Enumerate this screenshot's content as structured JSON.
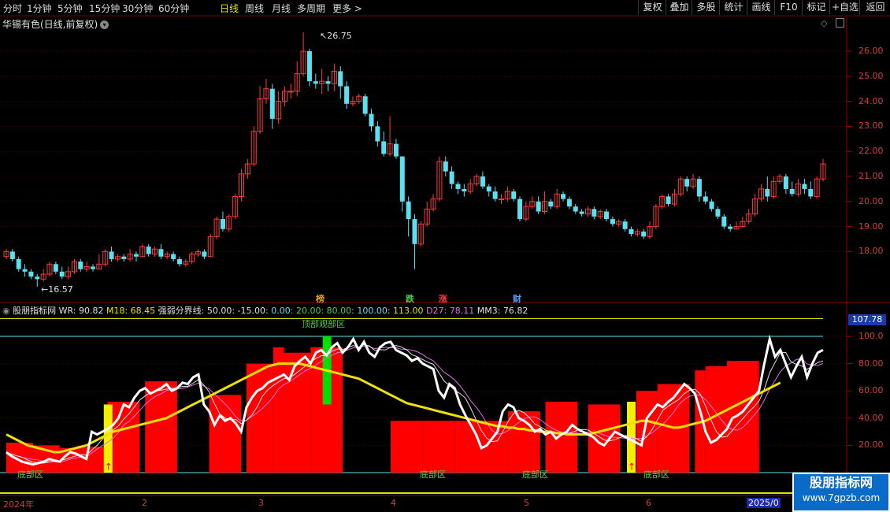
{
  "toolbar": {
    "periods": [
      "分时",
      "1分钟",
      "5分钟",
      "15分钟",
      "30分钟",
      "60分钟",
      "日线",
      "周线",
      "月线",
      "多周期",
      "更多 >"
    ],
    "active_period": "日线",
    "right_buttons": [
      "复权",
      "叠加",
      "多股",
      "统计",
      "画线",
      "F10",
      "标记",
      "+自选",
      "返回"
    ]
  },
  "main_chart": {
    "title": "华锡有色(日线,前复权)",
    "high_label": "26.75",
    "low_label": "16.57",
    "price_ticks": [
      "26.00",
      "25.00",
      "24.00",
      "23.00",
      "22.00",
      "21.00",
      "20.00",
      "19.00",
      "18.00"
    ],
    "event_markers": [
      "榜",
      "跌",
      "涨",
      "财"
    ]
  },
  "indicator": {
    "name": "股朋指标网",
    "wr_label": "WR: 90.82",
    "m18_label": "M18: 68.45",
    "boundary_prefix": "强弱分界线: 50.00",
    "boundary_values": [
      ": -15.00",
      ": 0.00",
      ": 20.00",
      ": 80.00",
      ": 100.00",
      ": 113.00"
    ],
    "d27_label": "D27: 78.11",
    "mm3_label": "MM3: 76.82",
    "top_value_badge": "107.78",
    "y_ticks": [
      "100.0",
      "80.00",
      "60.00",
      "40.00",
      "20.00"
    ],
    "zone_top": "顶部观部区",
    "zone_bottom": "底部区"
  },
  "time_axis": [
    "2024年",
    "2",
    "3",
    "4",
    "5",
    "6",
    "2025/0"
  ],
  "watermark": {
    "title": "股朋指标网",
    "url": "www.7gpzb.com"
  },
  "colors": {
    "up": "#ff3b3b",
    "down": "#5ce0f0",
    "wr": "#ffffff",
    "m18": "#f0e000",
    "bar": "#ff0000"
  },
  "chart_data": {
    "type": "candlestick",
    "candles": [
      [
        17.8,
        18.0,
        17.7,
        18.1
      ],
      [
        18.0,
        17.7,
        17.6,
        18.1
      ],
      [
        17.7,
        17.3,
        17.2,
        17.8
      ],
      [
        17.3,
        17.2,
        17.0,
        17.5
      ],
      [
        17.2,
        17.0,
        16.9,
        17.3
      ],
      [
        17.0,
        16.9,
        16.6,
        17.1
      ],
      [
        16.9,
        17.1,
        16.8,
        17.3
      ],
      [
        17.1,
        17.5,
        17.0,
        17.6
      ],
      [
        17.5,
        17.2,
        17.1,
        17.6
      ],
      [
        17.2,
        17.0,
        16.9,
        17.4
      ],
      [
        17.0,
        17.2,
        16.9,
        17.4
      ],
      [
        17.2,
        17.6,
        17.1,
        17.7
      ],
      [
        17.6,
        17.3,
        17.2,
        17.7
      ],
      [
        17.3,
        17.4,
        17.2,
        17.6
      ],
      [
        17.4,
        17.3,
        17.2,
        17.5
      ],
      [
        17.3,
        17.5,
        17.3,
        17.9
      ],
      [
        17.5,
        18.0,
        17.4,
        18.1
      ],
      [
        18.0,
        17.7,
        17.6,
        18.2
      ],
      [
        17.7,
        17.8,
        17.6,
        17.9
      ],
      [
        17.8,
        17.7,
        17.6,
        17.9
      ],
      [
        17.7,
        17.9,
        17.6,
        18.1
      ],
      [
        17.9,
        17.8,
        17.6,
        18.0
      ],
      [
        17.8,
        18.2,
        17.8,
        18.3
      ],
      [
        18.2,
        17.9,
        17.8,
        18.3
      ],
      [
        17.9,
        18.1,
        17.8,
        18.2
      ],
      [
        18.1,
        17.8,
        17.7,
        18.3
      ],
      [
        17.8,
        17.9,
        17.7,
        18.0
      ],
      [
        17.9,
        17.7,
        17.6,
        18.0
      ],
      [
        17.7,
        17.5,
        17.4,
        17.8
      ],
      [
        17.5,
        17.6,
        17.4,
        17.7
      ],
      [
        17.6,
        17.9,
        17.5,
        18.0
      ],
      [
        17.9,
        18.0,
        17.8,
        18.1
      ],
      [
        18.0,
        17.8,
        17.7,
        18.1
      ],
      [
        17.8,
        18.6,
        17.8,
        18.7
      ],
      [
        18.6,
        19.3,
        18.5,
        19.4
      ],
      [
        19.3,
        18.9,
        18.8,
        19.6
      ],
      [
        18.9,
        19.4,
        18.8,
        19.5
      ],
      [
        19.4,
        20.2,
        19.3,
        20.3
      ],
      [
        20.2,
        21.1,
        20.0,
        21.3
      ],
      [
        21.1,
        21.5,
        20.9,
        21.7
      ],
      [
        21.5,
        22.8,
        21.4,
        23.0
      ],
      [
        22.8,
        24.1,
        22.7,
        24.6
      ],
      [
        24.1,
        24.5,
        23.9,
        24.9
      ],
      [
        24.5,
        23.3,
        22.9,
        24.7
      ],
      [
        23.3,
        24.0,
        23.1,
        24.4
      ],
      [
        24.0,
        24.4,
        23.8,
        24.6
      ],
      [
        24.4,
        24.4,
        24.1,
        24.7
      ],
      [
        24.4,
        25.1,
        24.2,
        25.6
      ],
      [
        25.1,
        26.0,
        25.0,
        26.75
      ],
      [
        26.0,
        24.8,
        24.6,
        26.1
      ],
      [
        24.8,
        24.7,
        24.5,
        25.1
      ],
      [
        24.7,
        24.8,
        24.3,
        25.3
      ],
      [
        24.8,
        24.7,
        24.4,
        25.0
      ],
      [
        24.7,
        25.2,
        24.4,
        25.5
      ],
      [
        25.2,
        24.6,
        24.1,
        25.4
      ],
      [
        24.6,
        23.9,
        23.7,
        24.8
      ],
      [
        23.9,
        24.0,
        23.8,
        24.2
      ],
      [
        24.0,
        24.2,
        23.9,
        24.3
      ],
      [
        24.2,
        23.5,
        23.4,
        24.3
      ],
      [
        23.5,
        23.0,
        22.8,
        23.7
      ],
      [
        23.0,
        22.4,
        22.2,
        23.2
      ],
      [
        22.4,
        21.9,
        21.8,
        22.8
      ],
      [
        21.9,
        22.3,
        21.8,
        23.4
      ],
      [
        22.3,
        21.8,
        21.7,
        22.5
      ],
      [
        21.8,
        20.0,
        19.6,
        21.8
      ],
      [
        20.0,
        19.3,
        18.6,
        20.2
      ],
      [
        19.3,
        18.3,
        17.3,
        19.5
      ],
      [
        18.3,
        19.1,
        18.2,
        19.2
      ],
      [
        19.1,
        19.7,
        19.0,
        20.0
      ],
      [
        19.7,
        20.1,
        19.6,
        20.3
      ],
      [
        20.1,
        21.6,
        20.0,
        21.8
      ],
      [
        21.6,
        21.2,
        21.0,
        21.8
      ],
      [
        21.2,
        20.7,
        20.5,
        21.4
      ],
      [
        20.7,
        20.5,
        20.3,
        20.8
      ],
      [
        20.5,
        20.4,
        20.2,
        20.7
      ],
      [
        20.4,
        20.7,
        20.3,
        20.9
      ],
      [
        20.7,
        21.0,
        20.6,
        21.1
      ],
      [
        21.0,
        20.6,
        20.5,
        21.2
      ],
      [
        20.6,
        20.4,
        20.2,
        20.7
      ],
      [
        20.4,
        20.1,
        20.0,
        20.6
      ],
      [
        20.1,
        20.1,
        19.9,
        20.3
      ],
      [
        20.1,
        20.4,
        20.0,
        20.6
      ],
      [
        20.4,
        20.1,
        20.0,
        20.5
      ],
      [
        20.1,
        19.3,
        19.2,
        20.2
      ],
      [
        19.3,
        19.8,
        19.2,
        20.0
      ],
      [
        19.8,
        20.0,
        19.7,
        20.2
      ],
      [
        20.0,
        19.6,
        19.5,
        20.2
      ],
      [
        19.6,
        20.0,
        19.5,
        20.4
      ],
      [
        20.0,
        19.8,
        19.7,
        20.1
      ],
      [
        19.8,
        20.3,
        19.7,
        20.5
      ],
      [
        20.3,
        20.1,
        20.0,
        20.4
      ],
      [
        20.1,
        19.8,
        19.7,
        20.2
      ],
      [
        19.8,
        19.6,
        19.5,
        19.9
      ],
      [
        19.6,
        19.5,
        19.4,
        19.7
      ],
      [
        19.5,
        19.7,
        19.4,
        19.8
      ],
      [
        19.7,
        19.4,
        19.3,
        19.8
      ],
      [
        19.4,
        19.6,
        19.3,
        19.7
      ],
      [
        19.6,
        19.3,
        19.2,
        19.7
      ],
      [
        19.3,
        19.1,
        19.0,
        19.4
      ],
      [
        19.1,
        19.2,
        19.0,
        19.3
      ],
      [
        19.2,
        18.9,
        18.8,
        19.3
      ],
      [
        18.9,
        18.7,
        18.6,
        19.0
      ],
      [
        18.7,
        18.8,
        18.6,
        18.9
      ],
      [
        18.8,
        18.6,
        18.5,
        18.9
      ],
      [
        18.6,
        19.0,
        18.5,
        19.2
      ],
      [
        19.0,
        19.8,
        18.9,
        19.9
      ],
      [
        19.8,
        20.2,
        19.7,
        20.3
      ],
      [
        20.2,
        19.9,
        19.8,
        20.3
      ],
      [
        19.9,
        20.3,
        19.8,
        20.5
      ],
      [
        20.3,
        20.9,
        20.2,
        21.0
      ],
      [
        20.9,
        20.6,
        20.4,
        21.0
      ],
      [
        20.6,
        20.9,
        20.5,
        21.1
      ],
      [
        20.9,
        20.2,
        20.0,
        21.0
      ],
      [
        20.2,
        20.0,
        19.9,
        20.4
      ],
      [
        20.0,
        19.7,
        19.6,
        20.1
      ],
      [
        19.7,
        19.4,
        19.3,
        19.8
      ],
      [
        19.4,
        19.0,
        18.9,
        19.5
      ],
      [
        19.0,
        18.9,
        18.8,
        19.1
      ],
      [
        18.9,
        19.0,
        18.9,
        19.2
      ],
      [
        19.0,
        19.2,
        19.0,
        19.4
      ],
      [
        19.2,
        19.5,
        19.1,
        19.7
      ],
      [
        19.5,
        20.1,
        19.4,
        20.3
      ],
      [
        20.1,
        20.5,
        20.0,
        20.7
      ],
      [
        20.5,
        20.2,
        20.0,
        21.0
      ],
      [
        20.2,
        20.8,
        20.1,
        21.0
      ],
      [
        20.8,
        21.0,
        20.7,
        21.1
      ],
      [
        21.0,
        20.5,
        20.3,
        21.1
      ],
      [
        20.5,
        20.3,
        20.2,
        20.8
      ],
      [
        20.3,
        20.7,
        20.2,
        20.9
      ],
      [
        20.7,
        20.5,
        20.3,
        20.9
      ],
      [
        20.5,
        20.2,
        20.1,
        20.8
      ],
      [
        20.2,
        20.9,
        20.1,
        21.0
      ],
      [
        20.9,
        21.5,
        20.8,
        21.7
      ]
    ],
    "wr": [
      15,
      12,
      10,
      8,
      7,
      6,
      7,
      8,
      10,
      9,
      8,
      12,
      15,
      14,
      12,
      10,
      30,
      28,
      30,
      32,
      35,
      40,
      50,
      48,
      55,
      60,
      62,
      58,
      60,
      62,
      65,
      60,
      62,
      66,
      65,
      70,
      72,
      50,
      45,
      35,
      42,
      38,
      40,
      36,
      30,
      48,
      55,
      60,
      62,
      66,
      68,
      70,
      72,
      68,
      78,
      82,
      85,
      80,
      88,
      90,
      86,
      92,
      95,
      88,
      92,
      98,
      90,
      96,
      88,
      85,
      92,
      95,
      96,
      90,
      88,
      86,
      82,
      84,
      80,
      78,
      76,
      60,
      55,
      65,
      62,
      50,
      42,
      35,
      28,
      18,
      20,
      25,
      30,
      45,
      50,
      48,
      40,
      38,
      35,
      30,
      32,
      28,
      30,
      25,
      28,
      30,
      35,
      32,
      30,
      28,
      26,
      22,
      20,
      25,
      30,
      28,
      26,
      24,
      22,
      20,
      40,
      45,
      50,
      48,
      52,
      55,
      60,
      65,
      62,
      58,
      45,
      30,
      22,
      24,
      28,
      32,
      40,
      42,
      45,
      50,
      55,
      60,
      80,
      98,
      85,
      90,
      80,
      70,
      78,
      85,
      70,
      80,
      88,
      90
    ],
    "m18": [
      28,
      26,
      24,
      22,
      20,
      19,
      18,
      17,
      16,
      15,
      15,
      16,
      17,
      18,
      19,
      20,
      22,
      24,
      26,
      28,
      30,
      31,
      32,
      33,
      34,
      35,
      36,
      37,
      38,
      39,
      40,
      42,
      44,
      46,
      48,
      50,
      52,
      54,
      56,
      58,
      60,
      62,
      64,
      66,
      68,
      70,
      72,
      74,
      76,
      78,
      79,
      80,
      80,
      80,
      80,
      80,
      79,
      78,
      77,
      76,
      75,
      74,
      73,
      72,
      71,
      70,
      69,
      67,
      65,
      63,
      61,
      59,
      57,
      55,
      53,
      51,
      50,
      49,
      48,
      47,
      46,
      45,
      44,
      43,
      42,
      41,
      40,
      39,
      38,
      37,
      36,
      35,
      34,
      34,
      33,
      33,
      32,
      32,
      31,
      31,
      30,
      30,
      30,
      29,
      29,
      28,
      28,
      28,
      28,
      28,
      29,
      30,
      31,
      32,
      33,
      34,
      35,
      36,
      37,
      38,
      38,
      37,
      36,
      35,
      34,
      33,
      33,
      34,
      35,
      36,
      37,
      38,
      40,
      42,
      44,
      46,
      48,
      50,
      52,
      54,
      56,
      58,
      60,
      62,
      64,
      66
    ],
    "bars": [
      [
        0,
        22
      ],
      [
        5,
        20
      ],
      [
        10,
        18
      ],
      [
        14,
        19
      ],
      [
        19,
        52
      ],
      [
        26,
        67
      ],
      [
        38,
        57
      ],
      [
        45,
        80
      ],
      [
        50,
        92
      ],
      [
        52,
        88
      ],
      [
        57,
        92
      ],
      [
        72,
        38
      ],
      [
        78,
        38
      ],
      [
        84,
        38
      ],
      [
        88,
        38
      ],
      [
        94,
        45
      ],
      [
        101,
        52
      ],
      [
        109,
        50
      ],
      [
        118,
        60
      ],
      [
        122,
        65
      ],
      [
        129,
        75
      ],
      [
        131,
        78
      ],
      [
        135,
        82
      ]
    ]
  }
}
